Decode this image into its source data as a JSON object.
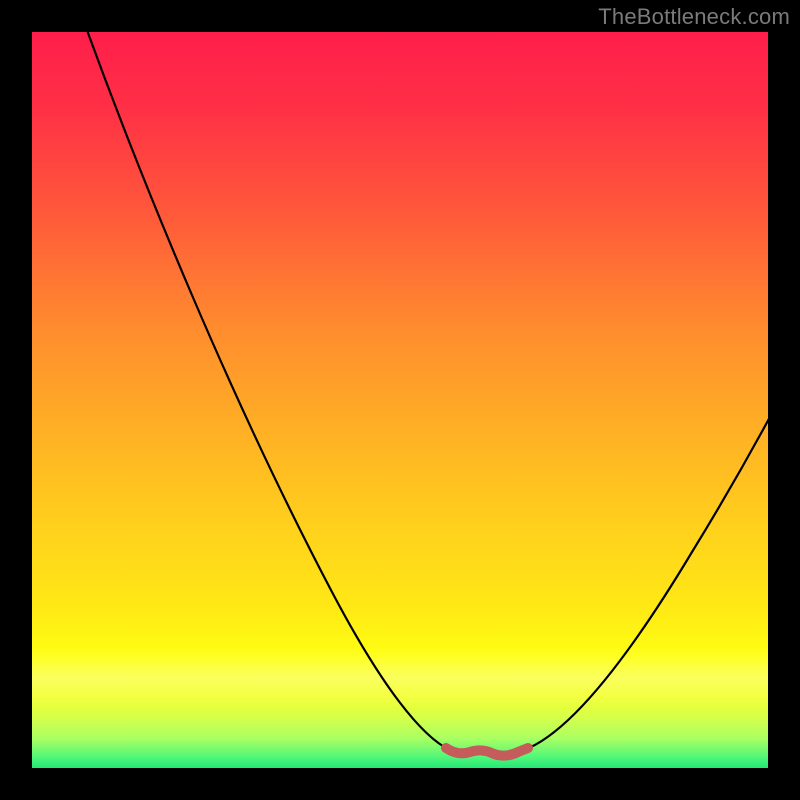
{
  "watermark": "TheBottleneck.com",
  "colors": {
    "frame": "#000000",
    "watermark_text": "#7a7a7a",
    "curve_line": "#000000",
    "optimum_marker": "#c65b5b",
    "gradient_top": "#ff1e4b",
    "gradient_bottom": "#23e876"
  },
  "chart_data": {
    "type": "line",
    "title": "",
    "xlabel": "",
    "ylabel": "",
    "xlim": [
      0,
      100
    ],
    "ylim": [
      0,
      100
    ],
    "notes": "Axis-less bottleneck curve over a vertical heat gradient. Y roughly represents bottleneck severity (0 = none at bottom, 100 = severe at top). X is relative component balance. The salmon segment marks the optimum (near-zero bottleneck) range.",
    "series": [
      {
        "name": "bottleneck_curve",
        "x": [
          7,
          12,
          18,
          24,
          30,
          36,
          42,
          47,
          52,
          55,
          58,
          60,
          63,
          66,
          70,
          76,
          82,
          88,
          94,
          100
        ],
        "y": [
          100,
          90,
          80,
          69,
          58,
          47,
          36,
          26,
          16,
          9,
          4,
          1,
          1,
          2,
          6,
          14,
          23,
          33,
          43,
          54
        ]
      }
    ],
    "optimum_range_x": [
      56,
      68
    ],
    "annotations": []
  }
}
